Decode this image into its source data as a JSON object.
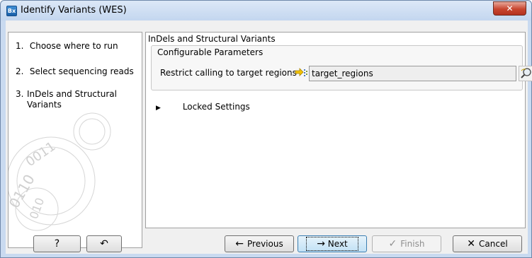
{
  "window": {
    "title": "Identify Variants (WES)",
    "app_icon_text": "Bx",
    "close_symbol": "✕"
  },
  "steps": [
    {
      "number": "1.",
      "label": "Choose where to run"
    },
    {
      "number": "2.",
      "label": "Select sequencing reads"
    },
    {
      "number": "3.",
      "label_line1": "InDels and Structural",
      "label_line2": "Variants"
    }
  ],
  "panel": {
    "title": "InDels and Structural Variants",
    "group_title": "Configurable Parameters",
    "param_label": "Restrict calling to target regions",
    "param_value": "target_regions",
    "locked_label": "Locked Settings",
    "locked_arrow": "▶"
  },
  "footer": {
    "help_label": "?",
    "reset_symbol": "↶",
    "previous_label": "Previous",
    "previous_arrow": "←",
    "next_label": "Next",
    "next_arrow": "→",
    "finish_label": "Finish",
    "finish_symbol": "✓",
    "cancel_label": "Cancel",
    "cancel_symbol": "✕"
  },
  "colors": {
    "title_bar": "#c9daf0",
    "close_button": "#c8452f",
    "default_button": "#c2e1f5"
  },
  "icons": [
    "app-icon",
    "close-icon",
    "track-icon",
    "browse-icon",
    "expand-arrow-icon",
    "help-icon",
    "reset-icon",
    "left-arrow-icon",
    "right-arrow-icon",
    "check-icon",
    "cancel-x-icon"
  ]
}
